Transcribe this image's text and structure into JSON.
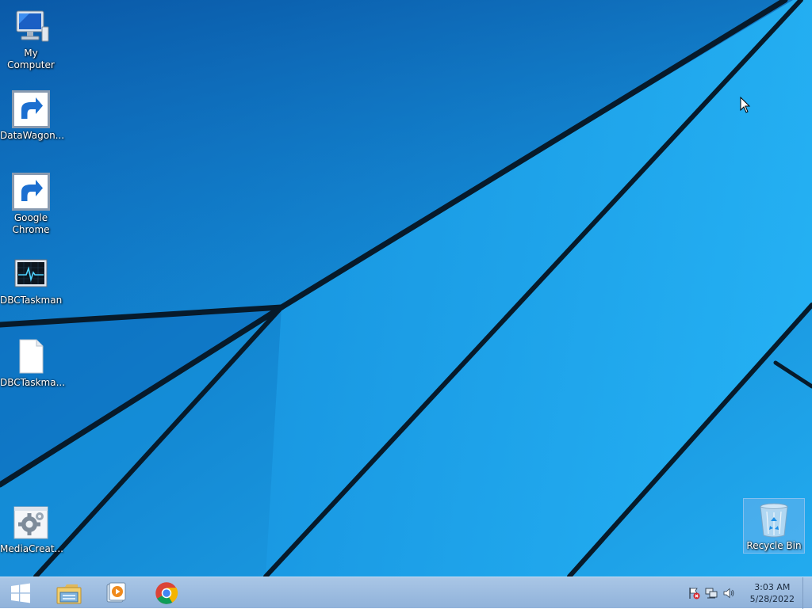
{
  "desktop": {
    "icons": [
      {
        "label": "My Computer",
        "icon": "computer-icon"
      },
      {
        "label": "DataWagon...",
        "icon": "gear-cluster-icon",
        "shortcut": true
      },
      {
        "label": "Google Chrome",
        "icon": "chrome-icon",
        "shortcut": true
      },
      {
        "label": "DBCTaskman",
        "icon": "monitor-pulse-icon"
      },
      {
        "label": "DBCTaskma...",
        "icon": "blank-file-icon"
      },
      {
        "label": "MediaCreat...",
        "icon": "settings-gear-icon"
      }
    ],
    "recycle_bin": {
      "label": "Recycle Bin",
      "icon": "recycle-bin-icon"
    }
  },
  "taskbar": {
    "start_icon": "windows-logo-icon",
    "pinned": [
      {
        "name": "File Explorer",
        "icon": "folder-icon"
      },
      {
        "name": "Media Player",
        "icon": "media-player-icon"
      },
      {
        "name": "Google Chrome",
        "icon": "chrome-icon"
      }
    ],
    "tray": {
      "icons": [
        "action-center-flag-icon",
        "network-icon",
        "volume-icon"
      ],
      "time": "3:03 AM",
      "date": "5/28/2022"
    }
  },
  "colors": {
    "wallpaper_light": "#1fa3e8",
    "wallpaper_dark": "#0a5fae",
    "taskbar": "#9fbde2"
  }
}
